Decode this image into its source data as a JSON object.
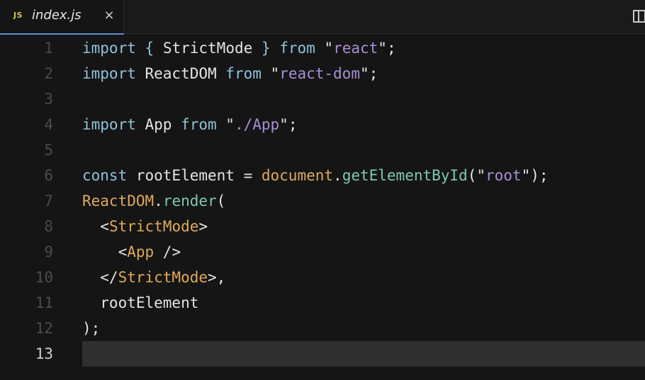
{
  "tab": {
    "icon_label": "JS",
    "file_name": "index.js",
    "close_glyph": "×"
  },
  "toolbar": {
    "split_icon": "split-editor-icon"
  },
  "colors": {
    "background": "#151515",
    "keyword": "#8fc2dc",
    "string": "#a88fd6",
    "component": "#e0a95c",
    "method": "#7fc8b1",
    "accent": "#5c8fd1"
  },
  "editor": {
    "current_line": 13,
    "lines": [
      {
        "n": "1",
        "tokens": [
          [
            "kw",
            "import"
          ],
          [
            "txt",
            " "
          ],
          [
            "kw",
            "{"
          ],
          [
            "txt",
            " StrictMode "
          ],
          [
            "kw",
            "}"
          ],
          [
            "txt",
            " "
          ],
          [
            "kw",
            "from"
          ],
          [
            "txt",
            " \""
          ],
          [
            "str",
            "react"
          ],
          [
            "txt",
            "\";"
          ]
        ]
      },
      {
        "n": "2",
        "tokens": [
          [
            "kw",
            "import"
          ],
          [
            "txt",
            " ReactDOM "
          ],
          [
            "kw",
            "from"
          ],
          [
            "txt",
            " \""
          ],
          [
            "str",
            "react-dom"
          ],
          [
            "txt",
            "\";"
          ]
        ]
      },
      {
        "n": "3",
        "tokens": []
      },
      {
        "n": "4",
        "tokens": [
          [
            "kw",
            "import"
          ],
          [
            "txt",
            " App "
          ],
          [
            "kw",
            "from"
          ],
          [
            "txt",
            " \""
          ],
          [
            "str",
            "./App"
          ],
          [
            "txt",
            "\";"
          ]
        ]
      },
      {
        "n": "5",
        "tokens": []
      },
      {
        "n": "6",
        "tokens": [
          [
            "kw",
            "const"
          ],
          [
            "txt",
            " rootElement = "
          ],
          [
            "cls",
            "document"
          ],
          [
            "txt",
            "."
          ],
          [
            "fn",
            "getElementById"
          ],
          [
            "txt",
            "(\""
          ],
          [
            "str",
            "root"
          ],
          [
            "txt",
            "\");"
          ]
        ]
      },
      {
        "n": "7",
        "tokens": [
          [
            "cls",
            "ReactDOM"
          ],
          [
            "txt",
            "."
          ],
          [
            "fn",
            "render"
          ],
          [
            "txt",
            "("
          ]
        ]
      },
      {
        "n": "8",
        "tokens": [
          [
            "txt",
            "  <"
          ],
          [
            "cls",
            "StrictMode"
          ],
          [
            "txt",
            ">"
          ]
        ]
      },
      {
        "n": "9",
        "tokens": [
          [
            "txt",
            "    <"
          ],
          [
            "cls",
            "App"
          ],
          [
            "txt",
            " />"
          ]
        ]
      },
      {
        "n": "10",
        "tokens": [
          [
            "txt",
            "  </"
          ],
          [
            "cls",
            "StrictMode"
          ],
          [
            "txt",
            ">,"
          ]
        ]
      },
      {
        "n": "11",
        "tokens": [
          [
            "txt",
            "  rootElement"
          ]
        ]
      },
      {
        "n": "12",
        "tokens": [
          [
            "txt",
            ");"
          ]
        ]
      },
      {
        "n": "13",
        "tokens": []
      }
    ]
  }
}
